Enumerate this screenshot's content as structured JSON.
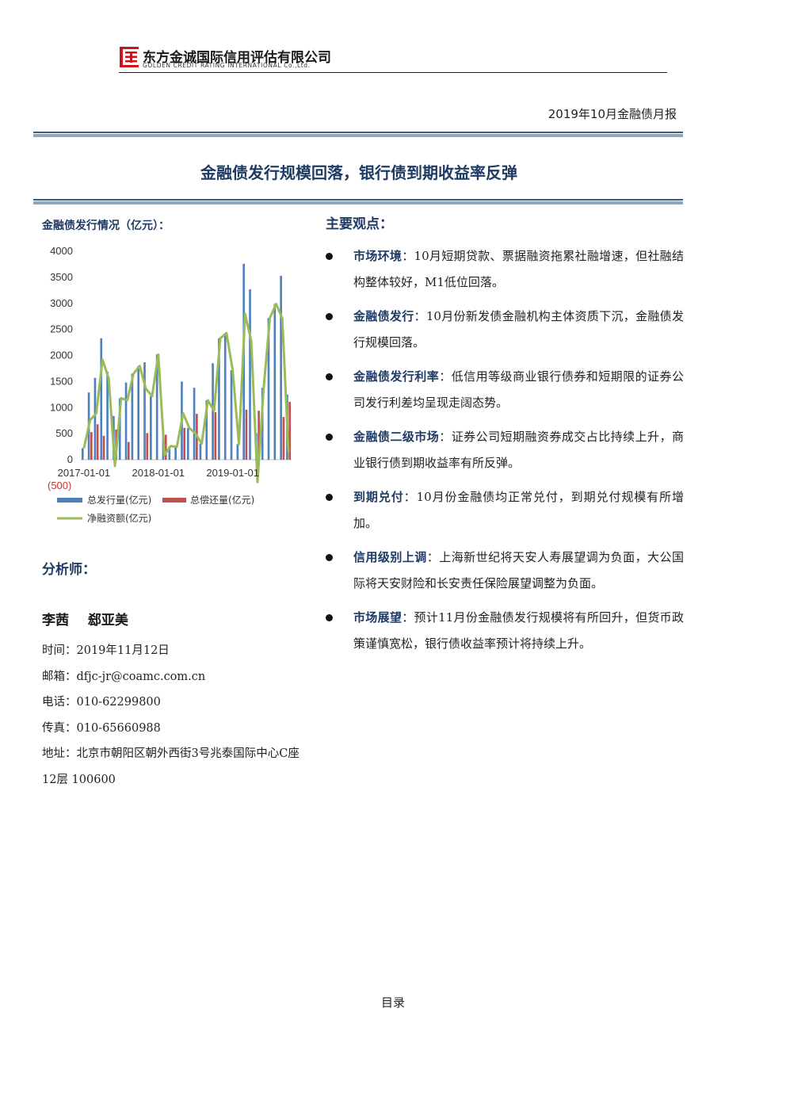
{
  "header": {
    "brand_cn": "东方金诚国际信用评估有限公司",
    "brand_en": "GOLDEN CREDIT RATING INTERNATIONAL Co.,Ltd.",
    "report_title": "2019年10月金融债月报"
  },
  "main_title": "金融债发行规模回落，银行债到期收益率反弹",
  "chart_caption": "金融债发行情况（亿元）：",
  "chart_data": {
    "type": "bar",
    "x_tick_labels": [
      "2017-01-01",
      "2018-01-01",
      "2019-01-01"
    ],
    "ylim": [
      -500,
      4000
    ],
    "y_ticks": [
      0,
      500,
      1000,
      1500,
      2000,
      2500,
      3000,
      3500,
      4000
    ],
    "y_tick_labels": [
      "(500)",
      "0",
      "500",
      "1000",
      "1500",
      "2000",
      "2500",
      "3000",
      "3500",
      "4000"
    ],
    "months": 34,
    "series": [
      {
        "name": "总发行量(亿元)",
        "kind": "bar",
        "color": "#4f81bd",
        "values": [
          220,
          1290,
          1570,
          2330,
          1690,
          840,
          1180,
          1480,
          1650,
          1800,
          1870,
          1220,
          2020,
          570,
          260,
          250,
          1500,
          610,
          1380,
          310,
          1140,
          1850,
          2330,
          2430,
          1720,
          300,
          3760,
          3270,
          510,
          1380,
          2720,
          2990,
          3530,
          1250
        ]
      },
      {
        "name": "总偿还量(亿元)",
        "kind": "bar",
        "color": "#c0504d",
        "values": [
          0,
          530,
          680,
          460,
          0,
          580,
          0,
          340,
          0,
          0,
          510,
          0,
          0,
          480,
          0,
          0,
          610,
          0,
          880,
          0,
          0,
          910,
          0,
          0,
          0,
          0,
          960,
          0,
          940,
          0,
          0,
          0,
          820,
          1110
        ]
      },
      {
        "name": "净融资额(亿元)",
        "kind": "line",
        "color": "#9bbb59",
        "values": [
          220,
          760,
          890,
          1920,
          1560,
          -120,
          1180,
          1140,
          1650,
          1800,
          1360,
          1220,
          2020,
          90,
          260,
          250,
          890,
          610,
          500,
          310,
          1140,
          940,
          2330,
          2430,
          1720,
          300,
          2800,
          2270,
          -430,
          1380,
          2720,
          2990,
          2710,
          140
        ]
      }
    ]
  },
  "main_points_heading": "主要观点：",
  "points": [
    {
      "keyword": "市场环境",
      "sep": "：",
      "text": "10月短期贷款、票据融资拖累社融增速，但社融结构整体较好，M1低位回落。"
    },
    {
      "keyword": "金融债发行",
      "sep": "：",
      "text": "10月份新发债金融机构主体资质下沉，金融债发行规模回落。"
    },
    {
      "keyword": "金融债发行利率",
      "sep": "：",
      "text": "低信用等级商业银行债券和短期限的证券公司发行利差均呈现走阔态势。"
    },
    {
      "keyword": "金融债二级市场",
      "sep": "：",
      "text": "证券公司短期融资券成交占比持续上升，商业银行债到期收益率有所反弹。"
    },
    {
      "keyword": "到期兑付",
      "sep": "：",
      "text": "10月份金融债均正常兑付，到期兑付规模有所增加。"
    },
    {
      "keyword": "信用级别上调",
      "sep": "：",
      "text": "上海新世纪将天安人寿展望调为负面，大公国际将天安财险和长安责任保险展望调整为负面。"
    },
    {
      "keyword": "市场展望",
      "sep": "：",
      "text": "预计11月份金融债发行规模将有所回升，但货币政策谨慎宽松，银行债收益率预计将持续上升。"
    }
  ],
  "analyst": {
    "heading": "分析师：",
    "names": "李茜 郄亚美",
    "contact": [
      "时间：2019年11月12日",
      "邮箱：dfjc-jr@coamc.com.cn",
      "电话：010-62299800",
      "传真：010-65660988",
      "地址：北京市朝阳区朝外西街3号兆泰国际中心C座12层 100600"
    ]
  },
  "footer": "目录",
  "colors": {
    "accent": "#1f3b63",
    "logo_red": "#c8161d"
  }
}
